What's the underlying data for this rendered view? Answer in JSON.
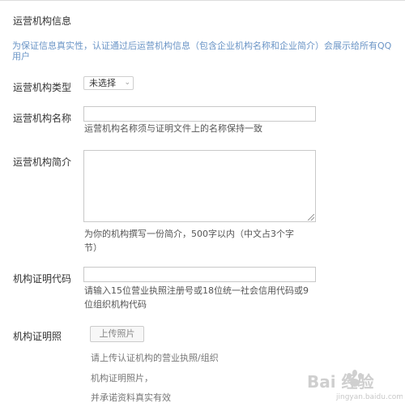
{
  "section": {
    "title": "运营机构信息",
    "notice": "为保证信息真实性，认证通过后运营机构信息（包含企业机构名称和企业简介）会展示给所有QQ用户"
  },
  "org_type": {
    "label": "运营机构类型",
    "selected": "未选择"
  },
  "org_name": {
    "label": "运营机构名称",
    "value": "",
    "hint": "运营机构名称须与证明文件上的名称保持一致"
  },
  "org_intro": {
    "label": "运营机构简介",
    "value": "",
    "hint_line1": "为你的机构撰写一份简介，500字以内（中文占3个字",
    "hint_line2": "节）"
  },
  "cert_code": {
    "label": "机构证明代码",
    "value": "",
    "hint_line1": "请输入15位营业执照注册号或18位统一社会信用代码或9",
    "hint_line2": "位组织机构代码"
  },
  "cert_photo": {
    "label": "机构证明照",
    "upload_label": "上传照片",
    "hint_line1": "请上传认证机构的营业执照/组织",
    "hint_line2": "机构证明照片，",
    "hint_line3": "并承诺资料真实有效"
  },
  "watermark": {
    "logo_text": "Bai 经验",
    "sub_text": "jingyan.baidu.com"
  }
}
